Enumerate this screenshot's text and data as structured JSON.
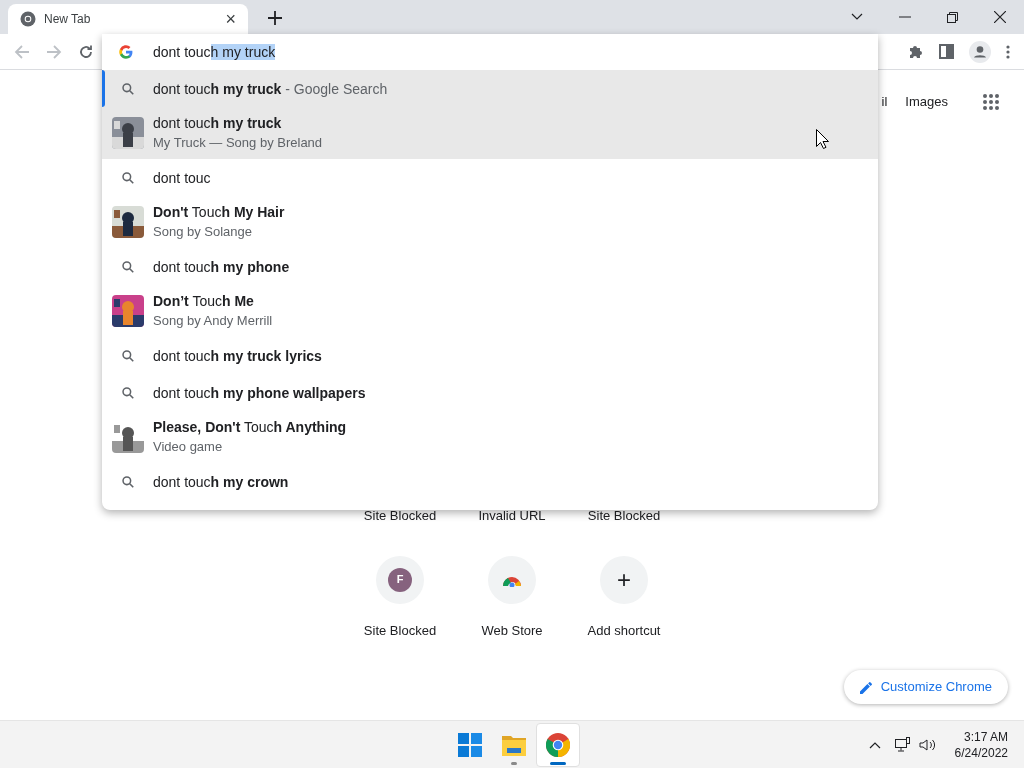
{
  "tab": {
    "title": "New Tab",
    "close": "×"
  },
  "omnibox": {
    "typed": "dont touc",
    "completion": "h my truck"
  },
  "suggestions": [
    {
      "kind": "search",
      "text": "dont touc**h my truck**",
      "suffix": "- Google Search",
      "selected": true,
      "hovered": false
    },
    {
      "kind": "entity",
      "text": "dont touc**h my truck**",
      "subtitle": "My Truck — Song by Breland",
      "selected": false,
      "hovered": true
    },
    {
      "kind": "search",
      "text": "dont touc",
      "selected": false,
      "hovered": false
    },
    {
      "kind": "entity",
      "text": "**Don't** Touc**h My Hair**",
      "subtitle": "Song by Solange",
      "selected": false,
      "hovered": false
    },
    {
      "kind": "search",
      "text": "dont touc**h my phone**",
      "selected": false,
      "hovered": false
    },
    {
      "kind": "entity",
      "text": "**Don’t** Touc**h Me**",
      "subtitle": "Song by Andy Merrill",
      "selected": false,
      "hovered": false
    },
    {
      "kind": "search",
      "text": "dont touc**h my truck lyrics**",
      "selected": false,
      "hovered": false
    },
    {
      "kind": "search",
      "text": "dont touc**h my phone wallpapers**",
      "selected": false,
      "hovered": false
    },
    {
      "kind": "entity",
      "text": "**Please, Don't** Touc**h Anything**",
      "subtitle": "Video game",
      "selected": false,
      "hovered": false
    },
    {
      "kind": "search",
      "text": "dont touc**h my crown**",
      "selected": false,
      "hovered": false
    }
  ],
  "header_links": [
    "il",
    "Images"
  ],
  "shortcuts_row_1": [
    "Site Blocked",
    "Invalid URL",
    "Site Blocked"
  ],
  "shortcuts_row_2": [
    {
      "kind": "letter",
      "letter": "F",
      "label": "Site Blocked"
    },
    {
      "kind": "store",
      "label": "Web Store"
    },
    {
      "kind": "add",
      "symbol": "+",
      "label": "Add shortcut"
    }
  ],
  "customize_button": "Customize Chrome",
  "taskbar": {
    "apps": [
      {
        "kind": "start",
        "running": false,
        "active": false
      },
      {
        "kind": "explorer",
        "running": true,
        "active": false
      },
      {
        "kind": "chrome",
        "running": true,
        "active": true
      }
    ],
    "time": "3:17 AM",
    "date": "6/24/2022"
  }
}
